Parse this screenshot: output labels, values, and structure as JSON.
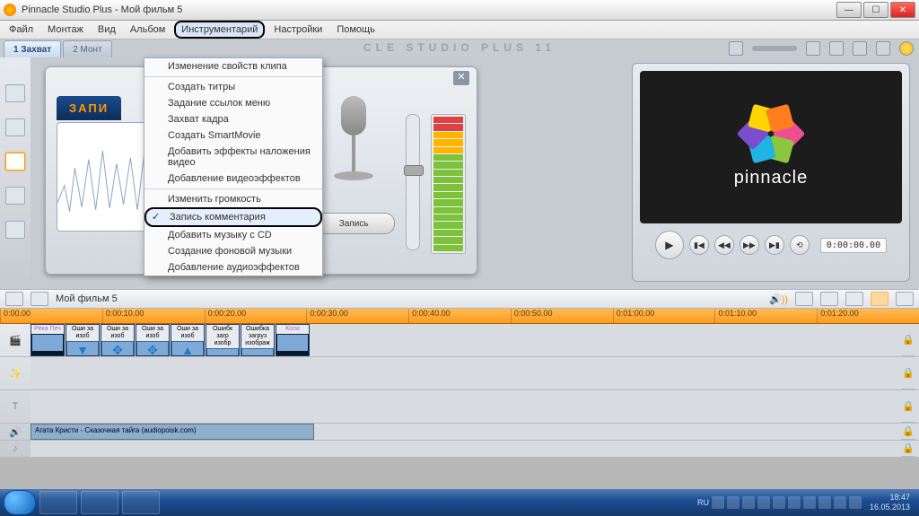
{
  "window": {
    "title": "Pinnacle Studio Plus - Мой фильм 5"
  },
  "menu": {
    "items": [
      "Файл",
      "Монтаж",
      "Вид",
      "Альбом",
      "Инструментарий",
      "Настройки",
      "Помощь"
    ],
    "open_index": 4
  },
  "tabs": {
    "t1": "1  Захват",
    "t2": "2  Монт"
  },
  "brand": "CLE  STUDIO  PLUS  11",
  "dropdown": {
    "groups": [
      [
        "Изменение свойств клипа"
      ],
      [
        "Создать титры",
        "Задание ссылок меню",
        "Захват кадра",
        "Создать SmartMovie",
        "Добавить эффекты наложения видео",
        "Добавление видеоэффектов"
      ],
      [
        "Изменить громкость",
        "Запись комментария",
        "Добавить музыку с CD",
        "Создание фоновой музыки",
        "Добавление аудиоэффектов"
      ]
    ],
    "checked": "Запись комментария"
  },
  "voice": {
    "label": "ЗАПИ",
    "button": "Запись"
  },
  "preview": {
    "brand": "pinnacle",
    "timecode": "0:00:00.00"
  },
  "tlheader": {
    "project": "Мой фильм 5"
  },
  "ruler": [
    "0:00.00",
    "0:00:10.00",
    "0:00:20.00",
    "0:00:30.00",
    "0:00:40.00",
    "0:00:50.00",
    "0:01:00.00",
    "0:01:10.00",
    "0:01:20.00"
  ],
  "clips": [
    {
      "label": "Река Печ",
      "first": true
    },
    {
      "label": "Оши за изоб",
      "arrow": "▼"
    },
    {
      "label": "Оши за изоб",
      "arrow": "✥"
    },
    {
      "label": "Оши за изоб",
      "arrow": "✥"
    },
    {
      "label": "Оши за изоб",
      "arrow": "▲"
    },
    {
      "label": "Ошибк загр изобр",
      "arrow": ""
    },
    {
      "label": "Ошибка загруз изображ",
      "arrow": ""
    },
    {
      "label": "Коли",
      "first": true
    }
  ],
  "audio_clip": "Агата Кристи - Сказочная тайга  (audiopoisk.com)",
  "taskbar": {
    "lang": "RU",
    "time": "18:47",
    "date": "16.05.2013"
  }
}
